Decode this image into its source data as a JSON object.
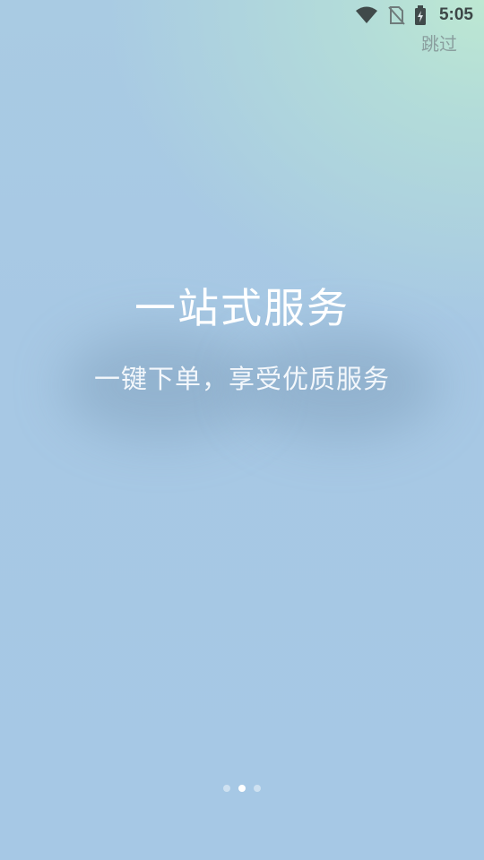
{
  "status_bar": {
    "time": "5:05",
    "icons": [
      "wifi-icon",
      "no-sim-icon",
      "battery-charging-icon"
    ]
  },
  "header": {
    "skip_label": "跳过"
  },
  "slide": {
    "title": "一站式服务",
    "subtitle": "一键下单，享受优质服务"
  },
  "pager": {
    "total": 3,
    "active_index": 1
  },
  "colors": {
    "background": "#a7c8e4",
    "accent_corner": "#bde8d2",
    "text": "#ffffff",
    "skip_text": "#8a9e9e"
  }
}
